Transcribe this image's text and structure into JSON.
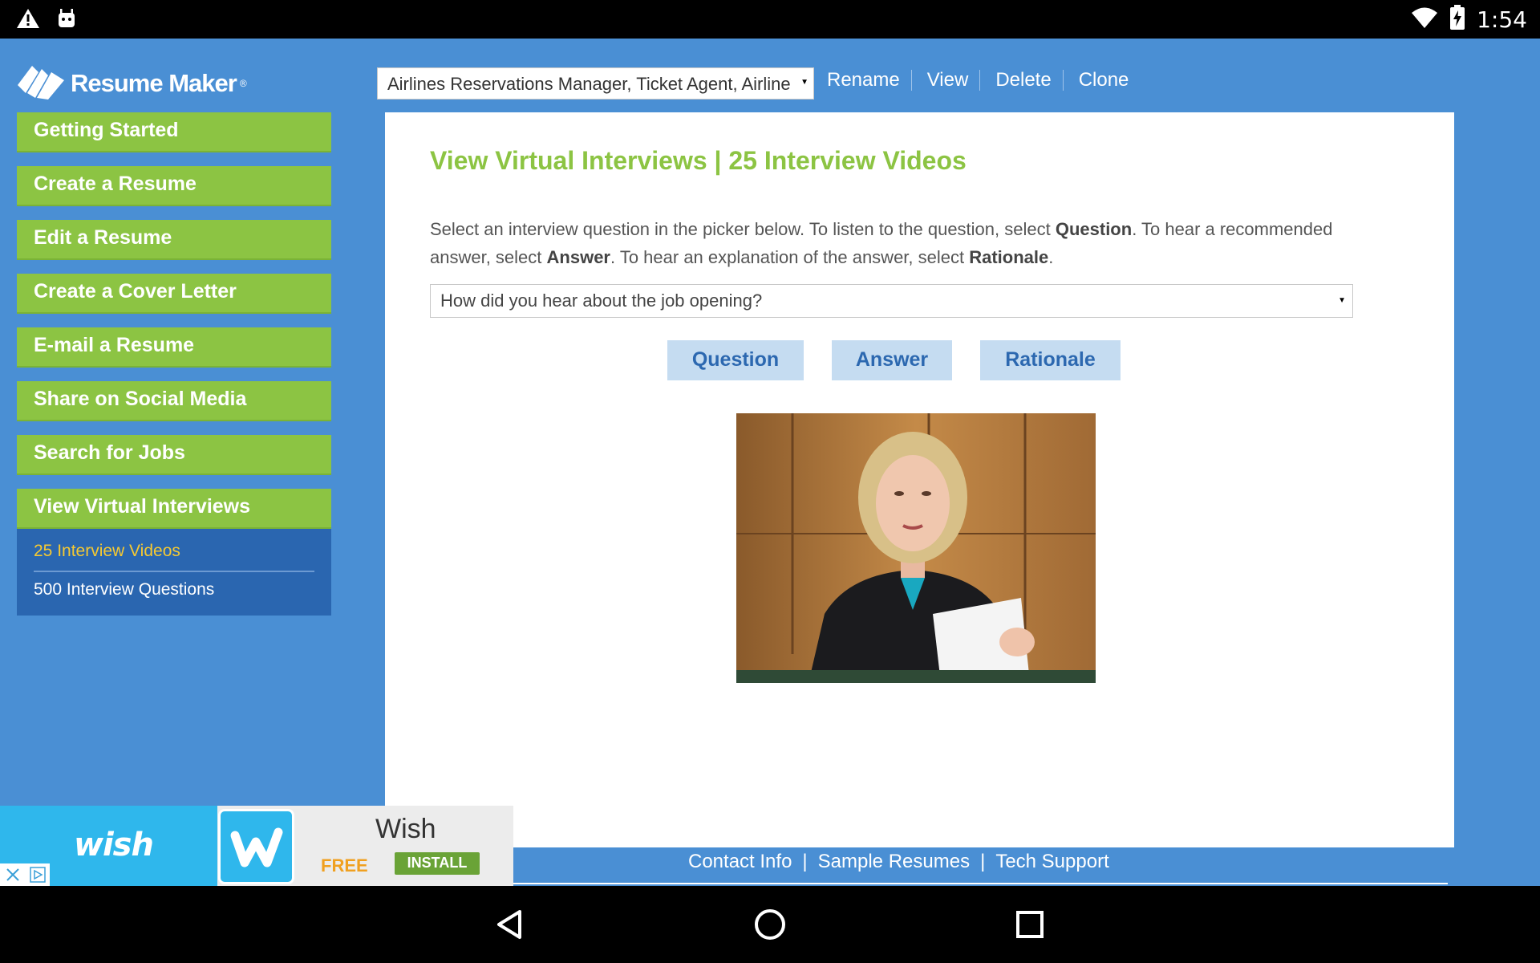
{
  "status_bar": {
    "time": "1:54",
    "icons": [
      "warning-icon",
      "android-debug-icon",
      "wifi-icon",
      "battery-charging-icon"
    ]
  },
  "app": {
    "logo_text": "Resume Maker",
    "logo_reg": "®"
  },
  "sidebar": {
    "items": [
      {
        "label": "Getting Started"
      },
      {
        "label": "Create a Resume"
      },
      {
        "label": "Edit a Resume"
      },
      {
        "label": "Create a Cover Letter"
      },
      {
        "label": "E-mail a Resume"
      },
      {
        "label": "Share on Social Media"
      },
      {
        "label": "Search for Jobs"
      },
      {
        "label": "View Virtual Interviews"
      }
    ],
    "subitems": [
      {
        "label": "25 Interview Videos",
        "selected": true
      },
      {
        "label": "500 Interview Questions",
        "selected": false
      }
    ]
  },
  "toolbar": {
    "resume_selected": "Airlines Reservations Manager, Ticket Agent, Airline",
    "links": [
      "Rename",
      "View",
      "Delete",
      "Clone"
    ]
  },
  "main": {
    "title": "View Virtual Interviews | 25 Interview Videos",
    "instructions": {
      "part1": "Select an interview question in the picker below. To listen to the question, select ",
      "b1": "Question",
      "part2": ". To hear a recommended answer, select ",
      "b2": "Answer",
      "part3": ". To hear an explanation of the answer, select ",
      "b3": "Rationale",
      "part4": "."
    },
    "question_selected": "How did you hear about the job opening?",
    "buttons": {
      "question": "Question",
      "answer": "Answer",
      "rationale": "Rationale"
    }
  },
  "footer": {
    "links": [
      "Contact Info",
      "Sample Resumes",
      "Tech Support"
    ],
    "separator": "|"
  },
  "ad": {
    "brand_logo": "wish",
    "app_name": "Wish",
    "price": "FREE",
    "cta": "INSTALL"
  },
  "colors": {
    "background": "#4a8fd4",
    "nav_green": "#8cc443",
    "subnav_blue": "#2a66b0",
    "selected_yellow": "#f5c932",
    "action_button_bg": "#c5dcf1",
    "action_button_text": "#2c68b0"
  }
}
